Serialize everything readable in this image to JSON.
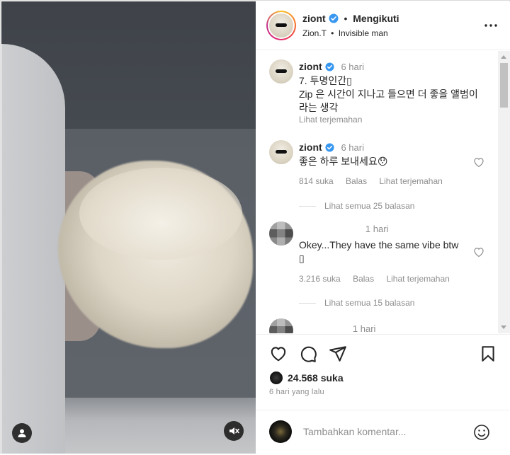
{
  "post": {
    "username": "ziont",
    "follow_status": "Mengikuti",
    "subtitle_artist": "Zion.T",
    "subtitle_song": "Invisible man",
    "dot": "•"
  },
  "comments": [
    {
      "username": "ziont",
      "time": "6 hari",
      "text": "7. 투명인간▯\nZip 은 시간이 지나고 들으면 더 좋을 앨범이라는 생각",
      "translate": "Lihat terjemahan"
    },
    {
      "username": "ziont",
      "time": "6 hari",
      "text": "좋은 하루 보내세요😯",
      "likes": "814 suka",
      "reply": "Balas",
      "translate": "Lihat terjemahan",
      "replies": "Lihat semua 25 balasan"
    },
    {
      "username": "",
      "time": "1 hari",
      "text": "Okey...They have the same vibe btw\n▯",
      "likes": "3.216 suka",
      "reply": "Balas",
      "translate": "Lihat terjemahan",
      "replies": "Lihat semua 15 balasan"
    },
    {
      "username": "",
      "time": "1 hari"
    }
  ],
  "footer": {
    "likes": "24.568 suka",
    "date": "6 hari yang lalu",
    "comment_placeholder": "Tambahkan komentar..."
  },
  "icons": {
    "like": "heart-icon",
    "comment": "comment-icon",
    "share": "send-icon",
    "save": "bookmark-icon",
    "more": "more-icon",
    "emoji": "emoji-icon",
    "mute": "mute-icon",
    "user": "user-icon",
    "verified": "verified-badge-icon"
  },
  "colors": {
    "verified": "#3897f0",
    "muted_text": "#8e8e8e"
  }
}
